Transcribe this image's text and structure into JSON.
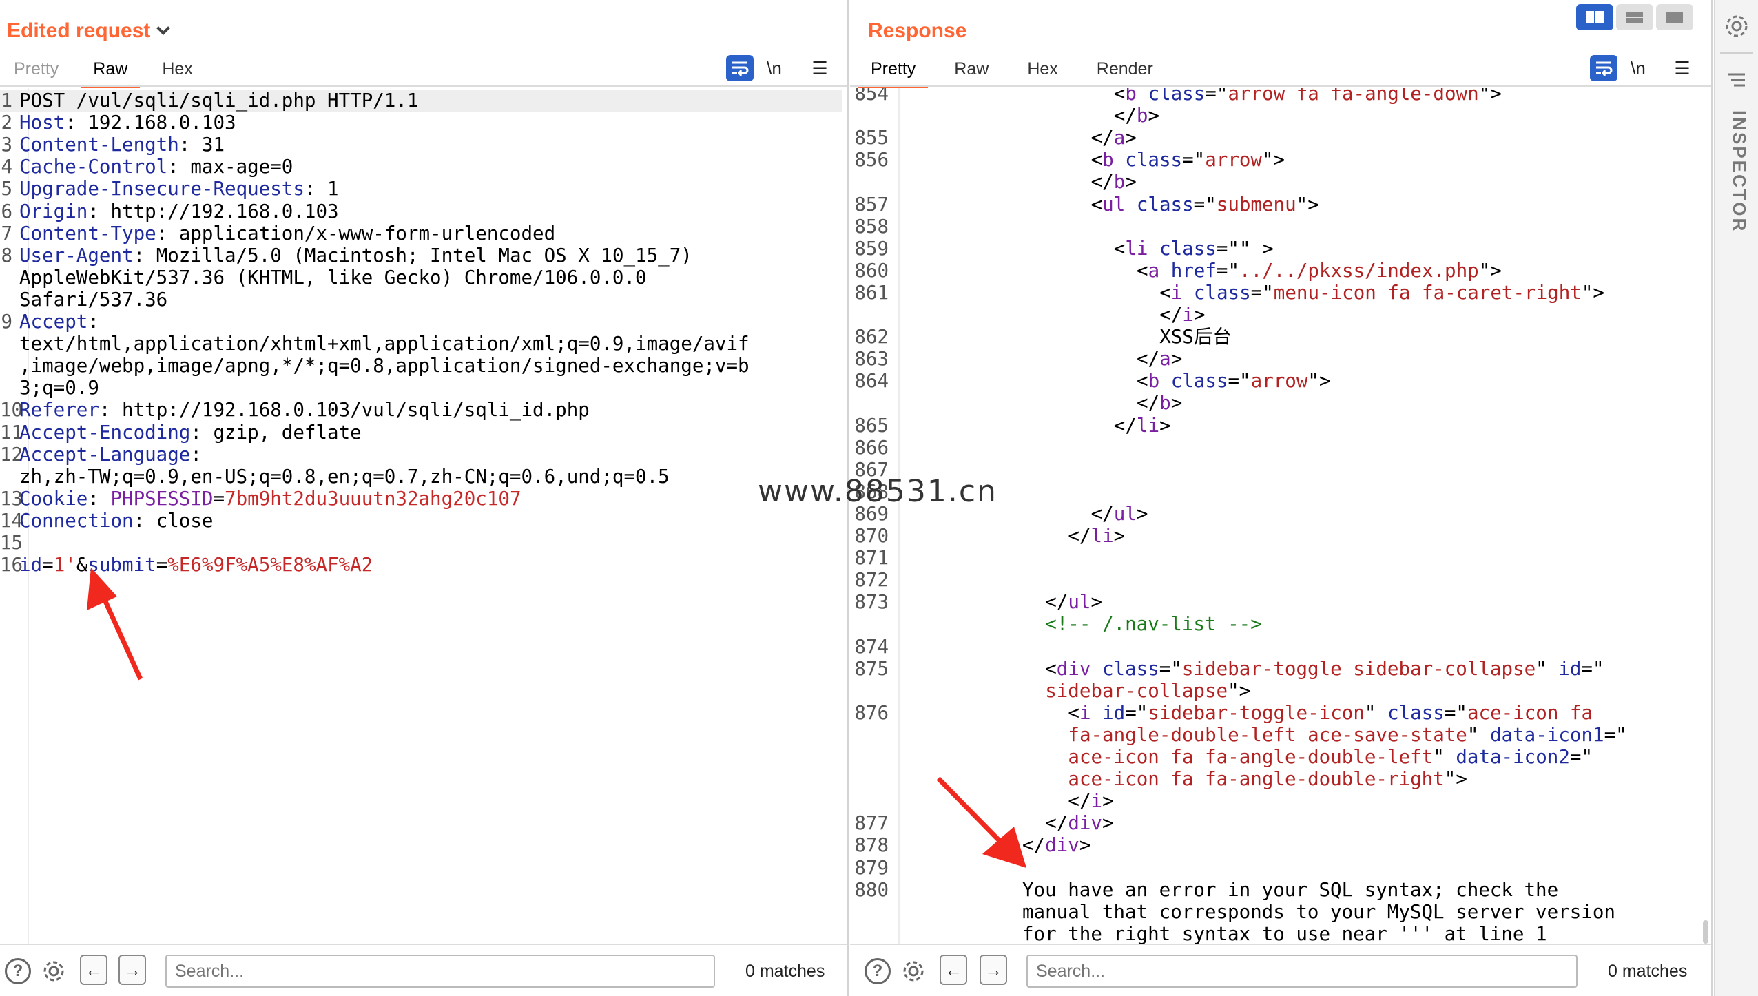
{
  "request": {
    "title": "Edited request",
    "tabs": [
      "Pretty",
      "Raw",
      "Hex"
    ],
    "active_tab": "Raw",
    "newline_label": "\\n",
    "lines": [
      {
        "n": "1",
        "parts": [
          [
            "v",
            "POST /vul/sqli/sqli_id.php HTTP/1.1"
          ]
        ]
      },
      {
        "n": "2",
        "parts": [
          [
            "k",
            "Host"
          ],
          [
            "v",
            ": 192.168.0.103"
          ]
        ]
      },
      {
        "n": "3",
        "parts": [
          [
            "k",
            "Content-Length"
          ],
          [
            "v",
            ": 31"
          ]
        ]
      },
      {
        "n": "4",
        "parts": [
          [
            "k",
            "Cache-Control"
          ],
          [
            "v",
            ": max-age=0"
          ]
        ]
      },
      {
        "n": "5",
        "parts": [
          [
            "k",
            "Upgrade-Insecure-Requests"
          ],
          [
            "v",
            ": 1"
          ]
        ]
      },
      {
        "n": "6",
        "parts": [
          [
            "k",
            "Origin"
          ],
          [
            "v",
            ": http://192.168.0.103"
          ]
        ]
      },
      {
        "n": "7",
        "parts": [
          [
            "k",
            "Content-Type"
          ],
          [
            "v",
            ": application/x-www-form-urlencoded"
          ]
        ]
      },
      {
        "n": "8",
        "parts": [
          [
            "k",
            "User-Agent"
          ],
          [
            "v",
            ": Mozilla/5.0 (Macintosh; Intel Mac OS X 10_15_7)"
          ]
        ]
      },
      {
        "n": "",
        "parts": [
          [
            "v",
            "AppleWebKit/537.36 (KHTML, like Gecko) Chrome/106.0.0.0"
          ]
        ]
      },
      {
        "n": "",
        "parts": [
          [
            "v",
            "Safari/537.36"
          ]
        ]
      },
      {
        "n": "9",
        "parts": [
          [
            "k",
            "Accept"
          ],
          [
            "v",
            ":"
          ]
        ]
      },
      {
        "n": "",
        "parts": [
          [
            "v",
            "text/html,application/xhtml+xml,application/xml;q=0.9,image/avif"
          ]
        ]
      },
      {
        "n": "",
        "parts": [
          [
            "v",
            ",image/webp,image/apng,*/*;q=0.8,application/signed-exchange;v=b"
          ]
        ]
      },
      {
        "n": "",
        "parts": [
          [
            "v",
            "3;q=0.9"
          ]
        ]
      },
      {
        "n": "10",
        "parts": [
          [
            "k",
            "Referer"
          ],
          [
            "v",
            ": http://192.168.0.103/vul/sqli/sqli_id.php"
          ]
        ]
      },
      {
        "n": "11",
        "parts": [
          [
            "k",
            "Accept-Encoding"
          ],
          [
            "v",
            ": gzip, deflate"
          ]
        ]
      },
      {
        "n": "12",
        "parts": [
          [
            "k",
            "Accept-Language"
          ],
          [
            "v",
            ":"
          ]
        ]
      },
      {
        "n": "",
        "parts": [
          [
            "v",
            "zh,zh-TW;q=0.9,en-US;q=0.8,en;q=0.7,zh-CN;q=0.6,und;q=0.5"
          ]
        ]
      },
      {
        "n": "13",
        "parts": [
          [
            "k",
            "Cookie"
          ],
          [
            "v",
            ": "
          ],
          [
            "tagc",
            "PHPSESSID"
          ],
          [
            "v",
            "="
          ],
          [
            "red",
            "7bm9ht2du3uuutn32ahg20c107"
          ]
        ]
      },
      {
        "n": "14",
        "parts": [
          [
            "k",
            "Connection"
          ],
          [
            "v",
            ": close"
          ]
        ]
      },
      {
        "n": "15",
        "parts": [
          [
            "v",
            ""
          ]
        ]
      },
      {
        "n": "16",
        "parts": [
          [
            "k",
            "id"
          ],
          [
            "v",
            "="
          ],
          [
            "red",
            "1'"
          ],
          [
            "v",
            "&"
          ],
          [
            "k",
            "submit"
          ],
          [
            "v",
            "="
          ],
          [
            "red",
            "%E6%9F%A5%E8%AF%A2"
          ]
        ]
      }
    ]
  },
  "response": {
    "title": "Response",
    "tabs": [
      "Pretty",
      "Raw",
      "Hex",
      "Render"
    ],
    "active_tab": "Pretty",
    "newline_label": "\\n",
    "lines": [
      {
        "n": "854",
        "i": 18,
        "parts": [
          [
            "v",
            "<"
          ],
          [
            "tagc",
            "b"
          ],
          [
            "v",
            " "
          ],
          [
            "attr",
            "class"
          ],
          [
            "v",
            "=\""
          ],
          [
            "str",
            "arrow fa fa-angle-down"
          ],
          [
            "v",
            "\">"
          ]
        ]
      },
      {
        "n": "",
        "i": 18,
        "parts": [
          [
            "v",
            "</"
          ],
          [
            "tagc",
            "b"
          ],
          [
            "v",
            ">"
          ]
        ]
      },
      {
        "n": "855",
        "i": 16,
        "parts": [
          [
            "v",
            "</"
          ],
          [
            "tagc",
            "a"
          ],
          [
            "v",
            ">"
          ]
        ]
      },
      {
        "n": "856",
        "i": 16,
        "parts": [
          [
            "v",
            "<"
          ],
          [
            "tagc",
            "b"
          ],
          [
            "v",
            " "
          ],
          [
            "attr",
            "class"
          ],
          [
            "v",
            "=\""
          ],
          [
            "str",
            "arrow"
          ],
          [
            "v",
            "\">"
          ]
        ]
      },
      {
        "n": "",
        "i": 16,
        "parts": [
          [
            "v",
            "</"
          ],
          [
            "tagc",
            "b"
          ],
          [
            "v",
            ">"
          ]
        ]
      },
      {
        "n": "857",
        "i": 16,
        "parts": [
          [
            "v",
            "<"
          ],
          [
            "tagc",
            "ul"
          ],
          [
            "v",
            " "
          ],
          [
            "attr",
            "class"
          ],
          [
            "v",
            "=\""
          ],
          [
            "str",
            "submenu"
          ],
          [
            "v",
            "\">"
          ]
        ]
      },
      {
        "n": "858",
        "i": 0,
        "parts": [
          [
            "v",
            ""
          ]
        ]
      },
      {
        "n": "859",
        "i": 18,
        "parts": [
          [
            "v",
            "<"
          ],
          [
            "tagc",
            "li"
          ],
          [
            "v",
            " "
          ],
          [
            "attr",
            "class"
          ],
          [
            "v",
            "=\"\" >"
          ]
        ]
      },
      {
        "n": "860",
        "i": 20,
        "parts": [
          [
            "v",
            "<"
          ],
          [
            "tagc",
            "a"
          ],
          [
            "v",
            " "
          ],
          [
            "attr",
            "href"
          ],
          [
            "v",
            "=\""
          ],
          [
            "str",
            "../../pkxss/index.php"
          ],
          [
            "v",
            "\">"
          ]
        ]
      },
      {
        "n": "861",
        "i": 22,
        "parts": [
          [
            "v",
            "<"
          ],
          [
            "tagc",
            "i"
          ],
          [
            "v",
            " "
          ],
          [
            "attr",
            "class"
          ],
          [
            "v",
            "=\""
          ],
          [
            "str",
            "menu-icon fa fa-caret-right"
          ],
          [
            "v",
            "\">"
          ]
        ]
      },
      {
        "n": "",
        "i": 22,
        "parts": [
          [
            "v",
            "</"
          ],
          [
            "tagc",
            "i"
          ],
          [
            "v",
            ">"
          ]
        ]
      },
      {
        "n": "862",
        "i": 22,
        "parts": [
          [
            "v",
            "XSS后台"
          ]
        ]
      },
      {
        "n": "863",
        "i": 20,
        "parts": [
          [
            "v",
            "</"
          ],
          [
            "tagc",
            "a"
          ],
          [
            "v",
            ">"
          ]
        ]
      },
      {
        "n": "864",
        "i": 20,
        "parts": [
          [
            "v",
            "<"
          ],
          [
            "tagc",
            "b"
          ],
          [
            "v",
            " "
          ],
          [
            "attr",
            "class"
          ],
          [
            "v",
            "=\""
          ],
          [
            "str",
            "arrow"
          ],
          [
            "v",
            "\">"
          ]
        ]
      },
      {
        "n": "",
        "i": 20,
        "parts": [
          [
            "v",
            "</"
          ],
          [
            "tagc",
            "b"
          ],
          [
            "v",
            ">"
          ]
        ]
      },
      {
        "n": "865",
        "i": 18,
        "parts": [
          [
            "v",
            "</"
          ],
          [
            "tagc",
            "li"
          ],
          [
            "v",
            ">"
          ]
        ]
      },
      {
        "n": "866",
        "i": 0,
        "parts": [
          [
            "v",
            ""
          ]
        ]
      },
      {
        "n": "867",
        "i": 0,
        "parts": [
          [
            "v",
            ""
          ]
        ]
      },
      {
        "n": "868",
        "i": 0,
        "parts": [
          [
            "v",
            ""
          ]
        ]
      },
      {
        "n": "869",
        "i": 16,
        "parts": [
          [
            "v",
            "</"
          ],
          [
            "tagc",
            "ul"
          ],
          [
            "v",
            ">"
          ]
        ]
      },
      {
        "n": "870",
        "i": 14,
        "parts": [
          [
            "v",
            "</"
          ],
          [
            "tagc",
            "li"
          ],
          [
            "v",
            ">"
          ]
        ]
      },
      {
        "n": "871",
        "i": 0,
        "parts": [
          [
            "v",
            ""
          ]
        ]
      },
      {
        "n": "872",
        "i": 0,
        "parts": [
          [
            "v",
            ""
          ]
        ]
      },
      {
        "n": "873",
        "i": 12,
        "parts": [
          [
            "v",
            "</"
          ],
          [
            "tagc",
            "ul"
          ],
          [
            "v",
            ">"
          ]
        ]
      },
      {
        "n": "",
        "i": 12,
        "parts": [
          [
            "cmt",
            "<!-- /.nav-list -->"
          ]
        ]
      },
      {
        "n": "874",
        "i": 0,
        "parts": [
          [
            "v",
            ""
          ]
        ]
      },
      {
        "n": "875",
        "i": 12,
        "parts": [
          [
            "v",
            "<"
          ],
          [
            "tagc",
            "div"
          ],
          [
            "v",
            " "
          ],
          [
            "attr",
            "class"
          ],
          [
            "v",
            "=\""
          ],
          [
            "str",
            "sidebar-toggle sidebar-collapse"
          ],
          [
            "v",
            "\" "
          ],
          [
            "attr",
            "id"
          ],
          [
            "v",
            "=\""
          ]
        ]
      },
      {
        "n": "",
        "i": 12,
        "parts": [
          [
            "str",
            "sidebar-collapse"
          ],
          [
            "v",
            "\">"
          ]
        ]
      },
      {
        "n": "876",
        "i": 14,
        "parts": [
          [
            "v",
            "<"
          ],
          [
            "tagc",
            "i"
          ],
          [
            "v",
            " "
          ],
          [
            "attr",
            "id"
          ],
          [
            "v",
            "=\""
          ],
          [
            "str",
            "sidebar-toggle-icon"
          ],
          [
            "v",
            "\" "
          ],
          [
            "attr",
            "class"
          ],
          [
            "v",
            "=\""
          ],
          [
            "str",
            "ace-icon fa"
          ]
        ]
      },
      {
        "n": "",
        "i": 14,
        "parts": [
          [
            "str",
            "fa-angle-double-left ace-save-state"
          ],
          [
            "v",
            "\" "
          ],
          [
            "attr",
            "data-icon1"
          ],
          [
            "v",
            "=\""
          ]
        ]
      },
      {
        "n": "",
        "i": 14,
        "parts": [
          [
            "str",
            "ace-icon fa fa-angle-double-left"
          ],
          [
            "v",
            "\" "
          ],
          [
            "attr",
            "data-icon2"
          ],
          [
            "v",
            "=\""
          ]
        ]
      },
      {
        "n": "",
        "i": 14,
        "parts": [
          [
            "str",
            "ace-icon fa fa-angle-double-right"
          ],
          [
            "v",
            "\">"
          ]
        ]
      },
      {
        "n": "",
        "i": 14,
        "parts": [
          [
            "v",
            "</"
          ],
          [
            "tagc",
            "i"
          ],
          [
            "v",
            ">"
          ]
        ]
      },
      {
        "n": "877",
        "i": 12,
        "parts": [
          [
            "v",
            "</"
          ],
          [
            "tagc",
            "div"
          ],
          [
            "v",
            ">"
          ]
        ]
      },
      {
        "n": "878",
        "i": 10,
        "parts": [
          [
            "v",
            "</"
          ],
          [
            "tagc",
            "div"
          ],
          [
            "v",
            ">"
          ]
        ]
      },
      {
        "n": "879",
        "i": 0,
        "parts": [
          [
            "v",
            ""
          ]
        ]
      },
      {
        "n": "880",
        "i": 10,
        "parts": [
          [
            "v",
            "You have an error in your SQL syntax; check the"
          ]
        ]
      },
      {
        "n": "",
        "i": 10,
        "parts": [
          [
            "v",
            "manual that corresponds to your MySQL server version"
          ]
        ]
      },
      {
        "n": "",
        "i": 10,
        "parts": [
          [
            "v",
            "for the right syntax to use near ''' at line 1"
          ]
        ]
      }
    ]
  },
  "search": {
    "placeholder": "Search...",
    "left_matches": "0 matches",
    "right_matches": "0 matches"
  },
  "inspector": {
    "label": "INSPECTOR"
  },
  "watermark": "www.88531.cn",
  "colors": {
    "accent": "#ff6633",
    "blue": "#2a62c9",
    "arrow": "#f0281e"
  }
}
